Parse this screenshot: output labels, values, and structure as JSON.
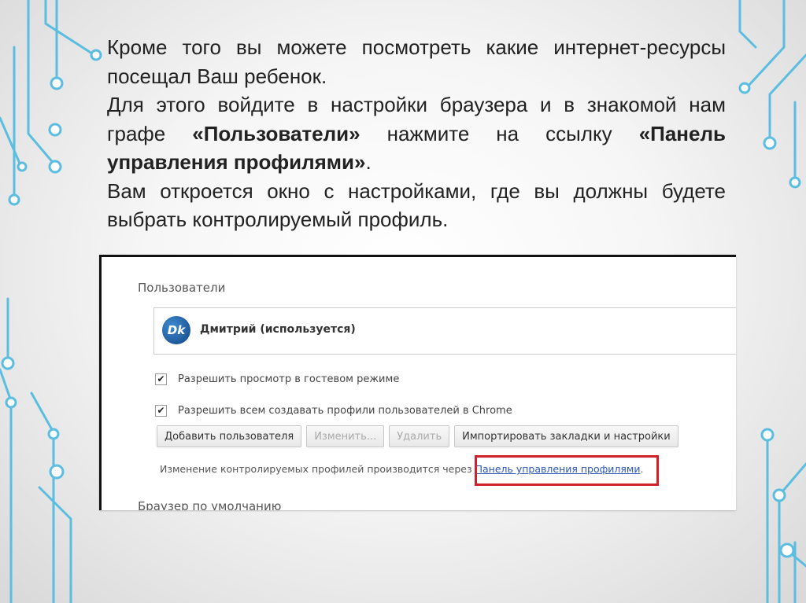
{
  "slide": {
    "text_p1_a": "Кроме того вы можете посмотреть какие интернет-ресурсы посещал Ваш ребенок.",
    "text_p2_a": "Для этого войдите в настройки браузера и в знакомой нам графе ",
    "text_p2_b": "«Пользователи»",
    "text_p2_c": " нажмите на ссылку ",
    "text_p2_d": "«Панель управления профилями»",
    "text_p2_e": ".",
    "text_p3": "Вам откроется окно с настройками, где вы должны будете выбрать контролируемый профиль."
  },
  "settings": {
    "section_title": "Пользователи",
    "user": {
      "avatar_text": "Dk",
      "name": "Дмитрий (используется)"
    },
    "checkboxes": [
      {
        "label": "Разрешить просмотр в гостевом режиме",
        "checked": true,
        "mark": "✔"
      },
      {
        "label": "Разрешить всем создавать профили пользователей в Chrome",
        "checked": true,
        "mark": "✔"
      }
    ],
    "buttons": {
      "add_user": "Добавить пользователя",
      "edit": "Изменить...",
      "delete": "Удалить",
      "import": "Импортировать закладки и настройки"
    },
    "manage_text": "Изменение контролируемых профилей производится через ",
    "manage_link": "Панель управления профилями",
    "manage_tail": ".",
    "next_section": "Браузер по умолчанию"
  },
  "colors": {
    "accent_line": "#4fb3d9",
    "highlight_border": "#d0202a",
    "link": "#2a56b8"
  }
}
